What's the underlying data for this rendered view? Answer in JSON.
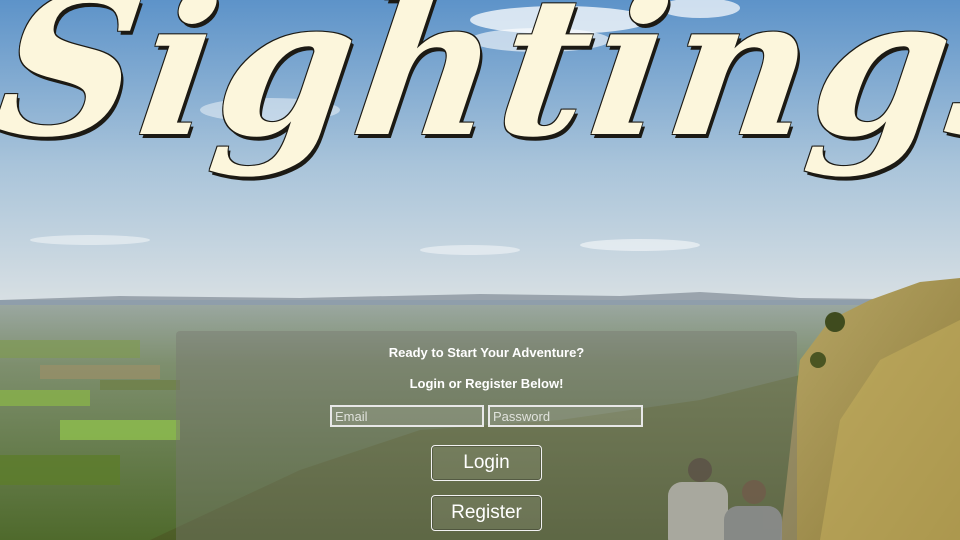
{
  "app": {
    "title": "Sightings"
  },
  "login_panel": {
    "heading": "Ready to Start Your Adventure?",
    "subheading": "Login or Register Below!",
    "email": {
      "value": "",
      "placeholder": "Email"
    },
    "password": {
      "value": "",
      "placeholder": "Password"
    },
    "login_label": "Login",
    "register_label": "Register"
  },
  "colors": {
    "title_fill": "#fcf6dc",
    "title_outline": "#1c1a14",
    "panel_overlay": "rgba(120, 120, 112, 0.42)"
  }
}
